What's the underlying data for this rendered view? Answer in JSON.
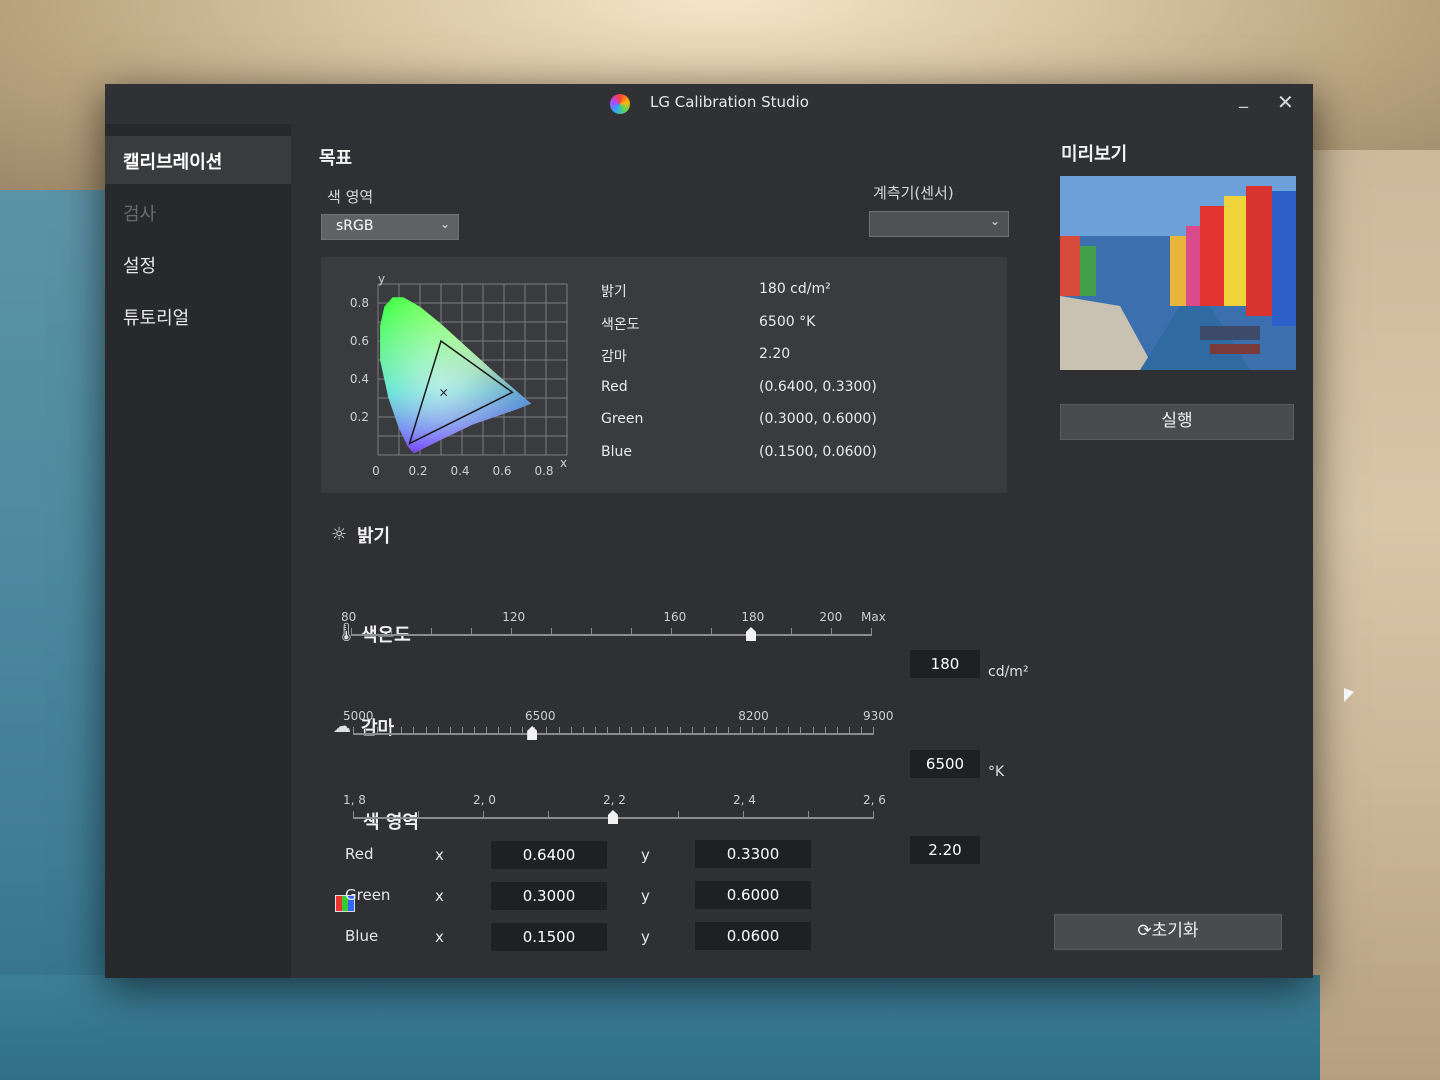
{
  "window": {
    "title": "LG Calibration Studio"
  },
  "sidebar": {
    "items": [
      {
        "label": "캘리브레이션",
        "state": "active"
      },
      {
        "label": "검사",
        "state": "disabled"
      },
      {
        "label": "설정",
        "state": "normal"
      },
      {
        "label": "튜토리얼",
        "state": "normal"
      }
    ]
  },
  "target": {
    "title": "목표",
    "gamut_label": "색 영역",
    "gamut_value": "sRGB",
    "sensor_label": "계측기(센서)",
    "sensor_value": "",
    "chart_data": {
      "type": "scatter",
      "ylabel": "y",
      "xlabel": "x",
      "x_ticks": [
        "0",
        "0.2",
        "0.4",
        "0.6",
        "0.8"
      ],
      "y_ticks": [
        "0.8",
        "0.6",
        "0.4",
        "0.2"
      ],
      "triangle": [
        [
          0.64,
          0.33
        ],
        [
          0.3,
          0.6
        ],
        [
          0.15,
          0.06
        ]
      ],
      "white_point": [
        0.3127,
        0.329
      ]
    },
    "specs": [
      {
        "key": "밝기",
        "value": "180 cd/m²"
      },
      {
        "key": "색온도",
        "value": "6500 °K"
      },
      {
        "key": "감마",
        "value": "2.20"
      },
      {
        "key": "Red",
        "value": "(0.6400, 0.3300)"
      },
      {
        "key": "Green",
        "value": "(0.3000, 0.6000)"
      },
      {
        "key": "Blue",
        "value": "(0.1500, 0.0600)"
      }
    ]
  },
  "brightness": {
    "title": "밝기",
    "ticks": [
      "80",
      "120",
      "160",
      "180",
      "200",
      "Max"
    ],
    "value": "180",
    "unit": "cd/m²",
    "level": 180
  },
  "color_temp": {
    "title": "색온도",
    "ticks": [
      "5000",
      "6500",
      "8200",
      "9300"
    ],
    "value": "6500",
    "unit": "°K",
    "level": 6500
  },
  "gamma": {
    "title": "감마",
    "ticks": [
      "1, 8",
      "2, 0",
      "2, 2",
      "2, 4",
      "2, 6"
    ],
    "value": "2.20",
    "level": 2.2
  },
  "gamut": {
    "title": "색 영역",
    "x_label": "x",
    "y_label": "y",
    "rows": [
      {
        "name": "Red",
        "x": "0.6400",
        "y": "0.3300"
      },
      {
        "name": "Green",
        "x": "0.3000",
        "y": "0.6000"
      },
      {
        "name": "Blue",
        "x": "0.1500",
        "y": "0.0600"
      }
    ]
  },
  "preview": {
    "title": "미리보기",
    "run_label": "실행",
    "reset_label": "초기화"
  }
}
